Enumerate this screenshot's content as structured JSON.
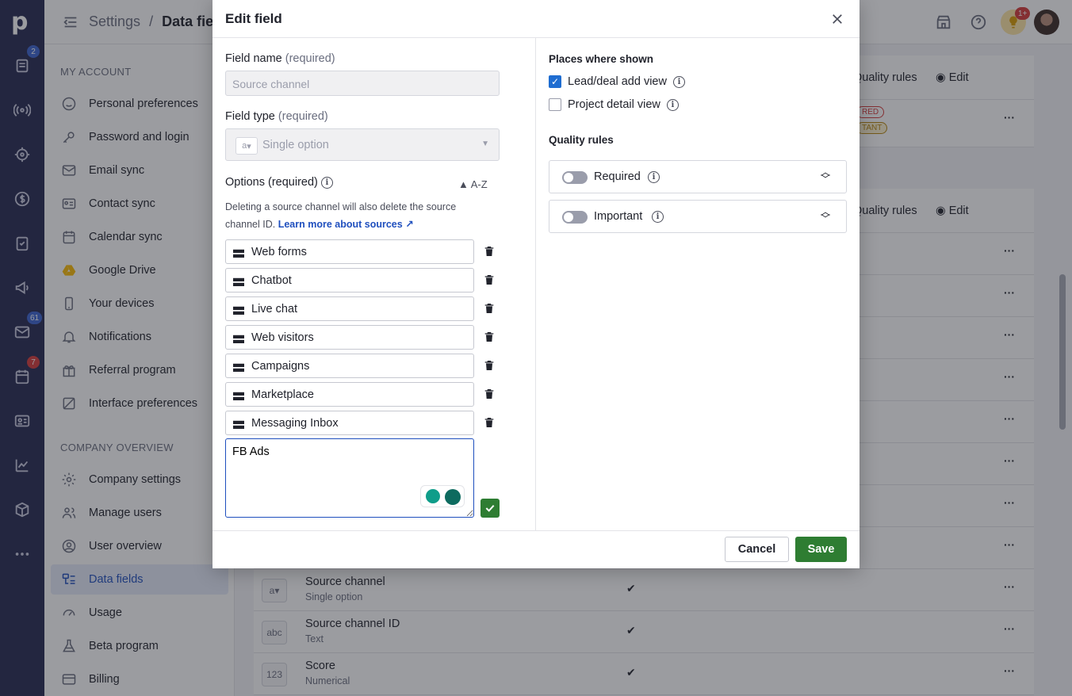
{
  "topbar": {
    "crumb_parent": "Settings",
    "crumb_sep": "/",
    "crumb_current": "Data fields",
    "notif_badge": "1+"
  },
  "rail": {
    "logo": "p",
    "badges": {
      "deals": "2",
      "mail": "61",
      "activities": "7"
    }
  },
  "sidebar": {
    "my_account_heading": "MY ACCOUNT",
    "my_account": [
      {
        "label": "Personal preferences",
        "icon": "smile-icon"
      },
      {
        "label": "Password and login",
        "icon": "key-icon"
      },
      {
        "label": "Email sync",
        "icon": "mail-icon"
      },
      {
        "label": "Contact sync",
        "icon": "contact-card-icon"
      },
      {
        "label": "Calendar sync",
        "icon": "calendar-icon"
      },
      {
        "label": "Google Drive",
        "icon": "google-drive-icon"
      },
      {
        "label": "Your devices",
        "icon": "phone-icon"
      },
      {
        "label": "Notifications",
        "icon": "bell-icon"
      },
      {
        "label": "Referral program",
        "icon": "gift-icon"
      },
      {
        "label": "Interface preferences",
        "icon": "layout-icon"
      }
    ],
    "company_heading": "COMPANY OVERVIEW",
    "company": [
      {
        "label": "Company settings",
        "icon": "gear-icon"
      },
      {
        "label": "Manage users",
        "icon": "users-icon"
      },
      {
        "label": "User overview",
        "icon": "user-circle-icon"
      },
      {
        "label": "Data fields",
        "icon": "data-fields-icon",
        "active": true
      },
      {
        "label": "Usage",
        "icon": "gauge-icon"
      },
      {
        "label": "Beta program",
        "icon": "flask-icon"
      },
      {
        "label": "Billing",
        "icon": "credit-card-icon"
      }
    ]
  },
  "background": {
    "quality_rules": "Quality rules",
    "edit": "Edit",
    "badge_required": "RED",
    "badge_important": "TANT",
    "rows": [
      {
        "name": "Source channel",
        "type": "Single option",
        "icon": "a▾"
      },
      {
        "name": "Source channel ID",
        "type": "Text",
        "icon": "abc"
      },
      {
        "name": "Score",
        "type": "Numerical",
        "icon": "123"
      }
    ]
  },
  "modal": {
    "title": "Edit field",
    "field_name_label": "Field name",
    "required_suffix": "(required)",
    "field_name_value": "Source channel",
    "field_type_label": "Field type",
    "field_type_value": "Single option",
    "field_type_icon": "a",
    "options_label": "Options (required)",
    "sort_label": "A-Z",
    "help_text": "Deleting a source channel will also delete the source channel ID.",
    "help_link": "Learn more about sources",
    "options": [
      "Web forms",
      "Chatbot",
      "Live chat",
      "Web visitors",
      "Campaigns",
      "Marketplace",
      "Messaging Inbox"
    ],
    "new_option_value": "FB Ads",
    "places_title": "Places where shown",
    "places": [
      {
        "label": "Lead/deal add view",
        "checked": true
      },
      {
        "label": "Project detail view",
        "checked": false
      }
    ],
    "quality_title": "Quality rules",
    "quality": [
      {
        "label": "Required",
        "on": false
      },
      {
        "label": "Important",
        "on": false
      }
    ],
    "cancel": "Cancel",
    "save": "Save"
  },
  "colors": {
    "rail": "#262850",
    "accent": "#1f4fbe",
    "save": "#2e7d32"
  }
}
